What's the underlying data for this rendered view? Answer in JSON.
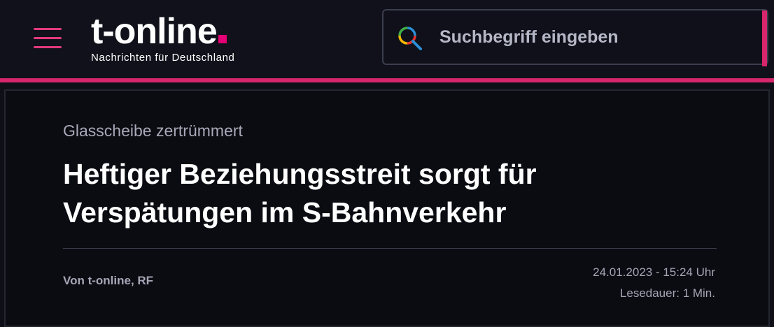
{
  "header": {
    "logo_text": "t-online",
    "tagline": "Nachrichten für Deutschland",
    "menu_icon": "hamburger-menu-icon",
    "accent_color": "#d8266c"
  },
  "search": {
    "placeholder": "Suchbegriff eingeben",
    "icon": "search-icon"
  },
  "article": {
    "kicker": "Glasscheibe zertrümmert",
    "headline": "Heftiger Beziehungsstreit sorgt für Verspätungen im S-Bahnverkehr",
    "author": "Von t-online, RF",
    "datetime": "24.01.2023 - 15:24 Uhr",
    "reading_time": "Lesedauer: 1 Min."
  }
}
